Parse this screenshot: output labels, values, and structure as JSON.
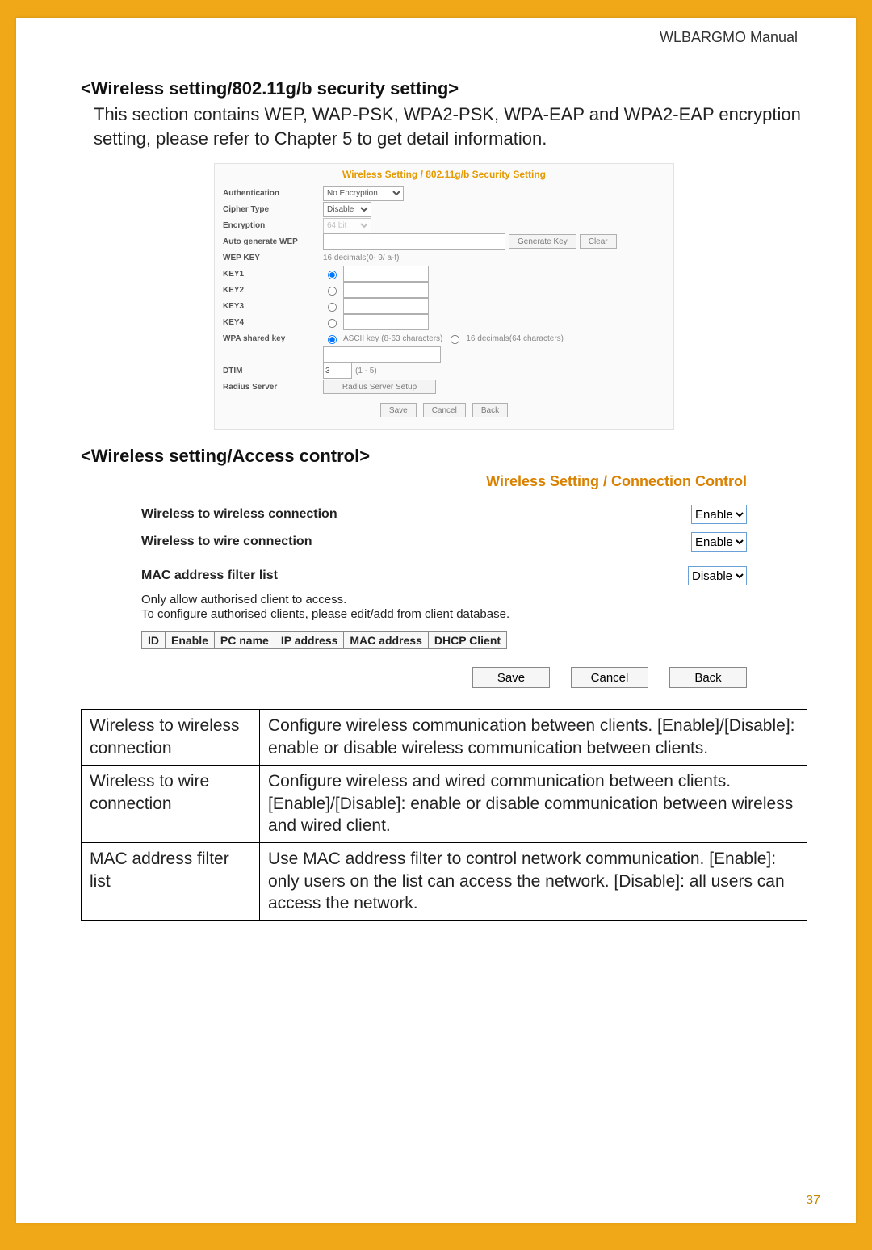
{
  "header": {
    "manual": "WLBARGMO Manual"
  },
  "page_number": "37",
  "section1": {
    "title": "<Wireless setting/802.11g/b security setting>",
    "body": "This section contains WEP, WAP-PSK, WPA2-PSK, WPA-EAP and WPA2-EAP encryption setting, please refer to Chapter 5 to get detail information."
  },
  "sec_panel": {
    "title": "Wireless Setting / 802.11g/b Security Setting",
    "rows": {
      "auth": "Authentication",
      "auth_val": "No Encryption",
      "cipher": "Cipher Type",
      "cipher_val": "Disable",
      "enc": "Encryption",
      "enc_val": "64 bit",
      "autogen": "Auto generate WEP",
      "genkey_btn": "Generate Key",
      "clear_btn": "Clear",
      "wepkey_lbl": "WEP KEY",
      "wepkey_hint": "16 decimals(0- 9/ a-f)",
      "k1": "KEY1",
      "k2": "KEY2",
      "k3": "KEY3",
      "k4": "KEY4",
      "wpa": "WPA shared key",
      "ascii": "ASCII key (8-63 characters)",
      "dec64": "16 decimals(64 characters)",
      "dtim": "DTIM",
      "dtim_val": "3",
      "dtim_range": "(1 - 5)",
      "radius": "Radius Server",
      "radius_btn": "Radius Server Setup",
      "save": "Save",
      "cancel": "Cancel",
      "back": "Back"
    }
  },
  "section2": {
    "title": "<Wireless setting/Access control>"
  },
  "cc_panel": {
    "title": "Wireless Setting / Connection Control",
    "row1": {
      "label": "Wireless to wireless connection",
      "value": "Enable"
    },
    "row2": {
      "label": "Wireless to wire connection",
      "value": "Enable"
    },
    "mac_label": "MAC address filter list",
    "mac_value": "Disable",
    "helper1": "Only allow authorised client to access.",
    "helper2": "To configure authorised clients, please edit/add from client database.",
    "cols": [
      "ID",
      "Enable",
      "PC name",
      "IP address",
      "MAC address",
      "DHCP Client"
    ],
    "save": "Save",
    "cancel": "Cancel",
    "back": "Back"
  },
  "exp_table": [
    {
      "k": "Wireless to wireless connection",
      "v": "Configure wireless communication between clients.\n[Enable]/[Disable]: enable or disable wireless communication between clients."
    },
    {
      "k": "Wireless to wire connection",
      "v": "Configure wireless and wired communication between clients.\n[Enable]/[Disable]: enable or disable communication between wireless and wired client."
    },
    {
      "k": "MAC address filter list",
      "v": "Use MAC address filter to control network communication.\n[Enable]: only users on the list can access the network.\n[Disable]: all users can access the network."
    }
  ]
}
